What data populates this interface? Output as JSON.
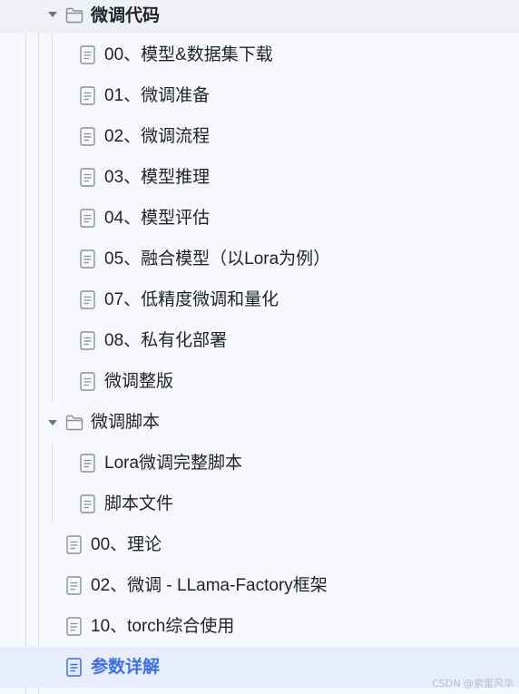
{
  "tree": {
    "folder_code": {
      "label": "微调代码",
      "children": [
        "00、模型&数据集下载",
        "01、微调准备",
        "02、微调流程",
        "03、模型推理",
        "04、模型评估",
        "05、融合模型（以Lora为例）",
        "07、低精度微调和量化",
        "08、私有化部署",
        "微调整版"
      ]
    },
    "folder_script": {
      "label": "微调脚本",
      "children": [
        "Lora微调完整脚本",
        "脚本文件"
      ]
    },
    "root_items": [
      "00、理论",
      "02、微调 - LLama-Factory框架",
      "10、torch综合使用",
      "参数详解"
    ]
  },
  "watermark": "CSDN @索雷风华",
  "colors": {
    "background": "#f7f8fb",
    "active_background": "#e8edfb",
    "active_text": "#3f6fe0",
    "icon_gray": "#8a8f99",
    "guide_line": "#d8dce3"
  },
  "icons": {
    "folder": "folder-outline-icon",
    "document": "document-icon",
    "caret": "caret-down-icon"
  }
}
